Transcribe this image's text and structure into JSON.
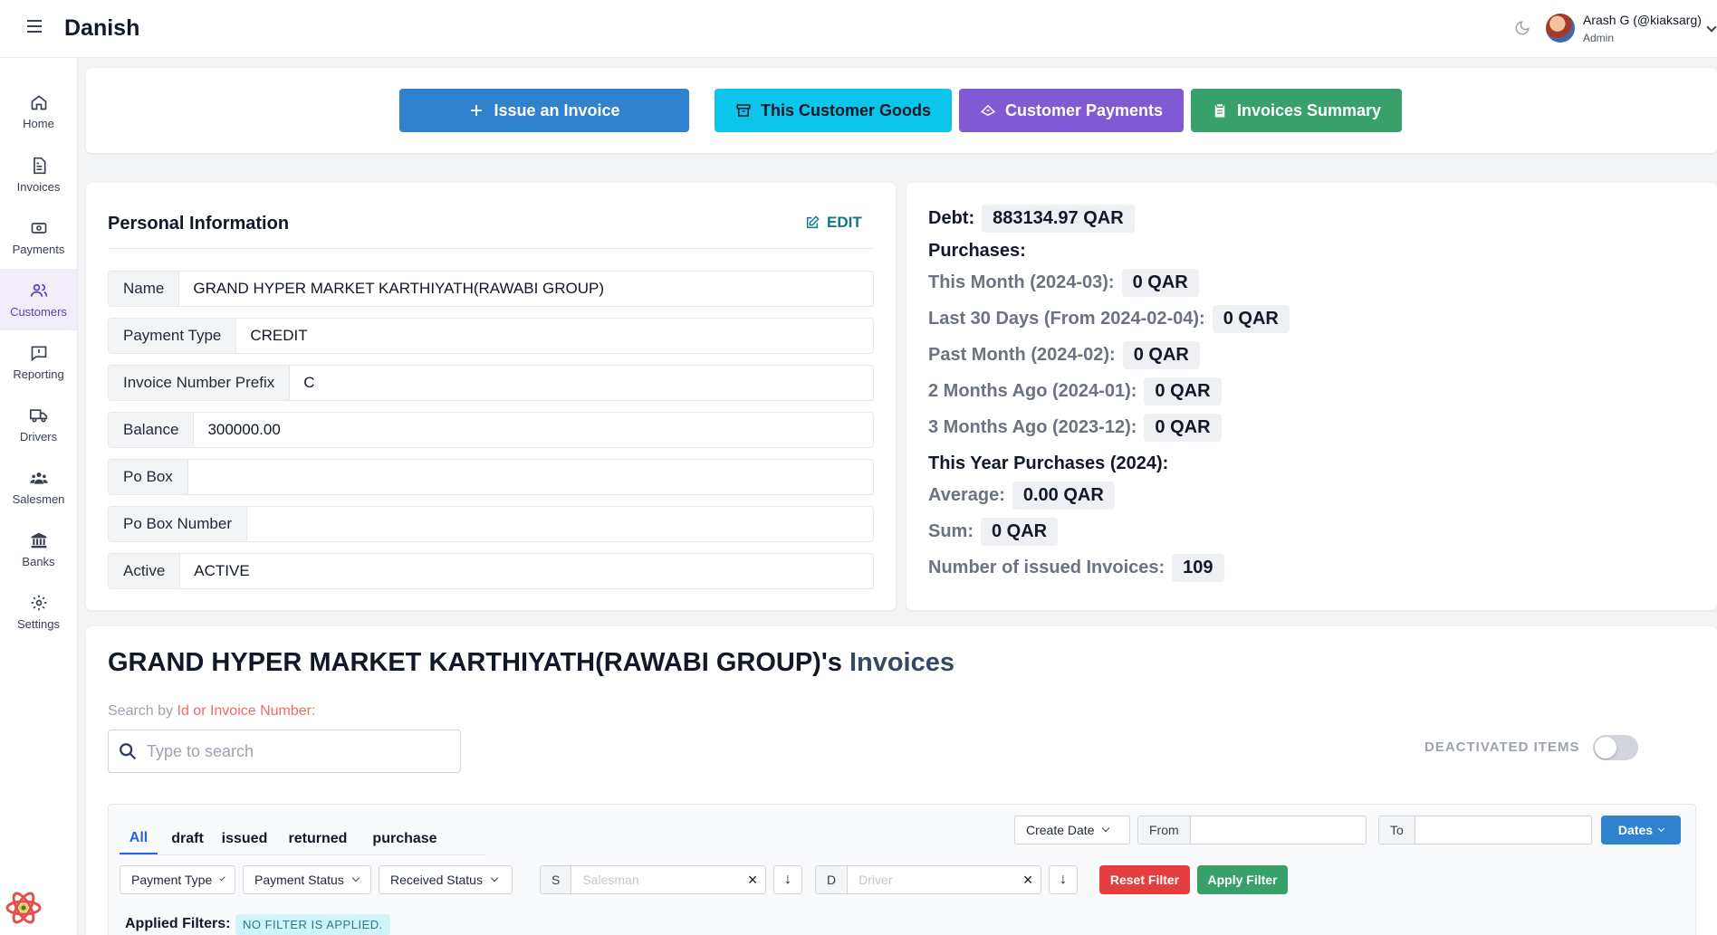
{
  "app": {
    "brand": "Danish"
  },
  "user": {
    "name": "Arash G (@kiaksarg)",
    "role": "Admin"
  },
  "nav": [
    {
      "label": "Home",
      "icon": "home-icon"
    },
    {
      "label": "Invoices",
      "icon": "file-icon"
    },
    {
      "label": "Payments",
      "icon": "money-icon"
    },
    {
      "label": "Customers",
      "icon": "users-icon",
      "active": true
    },
    {
      "label": "Reporting",
      "icon": "report-icon"
    },
    {
      "label": "Drivers",
      "icon": "truck-icon"
    },
    {
      "label": "Salesmen",
      "icon": "group-icon"
    },
    {
      "label": "Banks",
      "icon": "bank-icon"
    },
    {
      "label": "Settings",
      "icon": "gear-icon"
    }
  ],
  "actions": {
    "issue": "Issue an Invoice",
    "goods": "This Customer Goods",
    "payments": "Customer Payments",
    "summary": "Invoices Summary",
    "colors": {
      "issue": "#3182ce",
      "goods": "#0bc5ea",
      "payments": "#805ad5",
      "summary": "#38a169"
    }
  },
  "personal": {
    "title": "Personal Information",
    "edit": "EDIT",
    "fields": [
      {
        "label": "Name",
        "value": "GRAND HYPER MARKET KARTHIYATH(RAWABI GROUP)"
      },
      {
        "label": "Payment Type",
        "value": "CREDIT"
      },
      {
        "label": "Invoice Number Prefix",
        "value": "C"
      },
      {
        "label": "Balance",
        "value": "300000.00"
      },
      {
        "label": "Po Box",
        "value": ""
      },
      {
        "label": "Po Box Number",
        "value": ""
      },
      {
        "label": "Active",
        "value": "ACTIVE"
      }
    ]
  },
  "stats": {
    "debt_label": "Debt:",
    "debt_value": "883134.97 QAR",
    "purchases_label": "Purchases:",
    "this_month_label": "This Month (2024-03):",
    "this_month_value": "0 QAR",
    "last30_label": "Last 30 Days (From 2024-02-04):",
    "last30_value": "0 QAR",
    "past_month_label": "Past Month (2024-02):",
    "past_month_value": "0 QAR",
    "two_months_label": "2 Months Ago (2024-01):",
    "two_months_value": "0 QAR",
    "three_months_label": "3 Months Ago (2023-12):",
    "three_months_value": "0 QAR",
    "year_label": "This Year Purchases (2024):",
    "average_label": "Average:",
    "average_value": "0.00 QAR",
    "sum_label": "Sum:",
    "sum_value": "0 QAR",
    "issued_label": "Number of issued Invoices:",
    "issued_value": "109"
  },
  "invoices": {
    "title_customer": "GRAND HYPER MARKET KARTHIYATH(RAWABI GROUP)'s",
    "title_suffix": "Invoices",
    "search_label_pre": "Search by",
    "search_label_red": "Id or Invoice Number:",
    "search_placeholder": "Type to search",
    "deactivated_label": "DEACTIVATED ITEMS",
    "tabs": [
      "All",
      "draft",
      "issued",
      "returned",
      "purchase"
    ],
    "create_date": "Create Date",
    "from": "From",
    "to": "To",
    "dates": "Dates",
    "payment_type": "Payment Type",
    "payment_status": "Payment Status",
    "received_status": "Received Status",
    "salesman_prefix": "S",
    "salesman_placeholder": "Salesman",
    "driver_prefix": "D",
    "driver_placeholder": "Driver",
    "reset": "Reset Filter",
    "apply": "Apply Filter",
    "applied_label": "Applied Filters:",
    "no_filter": "NO FILTER IS APPLIED."
  }
}
